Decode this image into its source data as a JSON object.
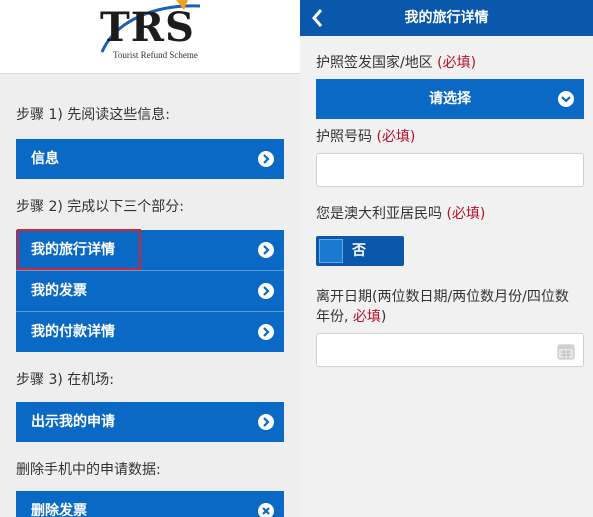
{
  "left": {
    "logo": {
      "text": "TRS",
      "subtitle": "Tourist Refund Scheme"
    },
    "step1_label": "步骤 1) 先阅读这些信息:",
    "step1_buttons": [
      "信息"
    ],
    "step2_label": "步骤 2) 完成以下三个部分:",
    "step2_buttons": [
      "我的旅行详情",
      "我的发票",
      "我的付款详情"
    ],
    "step3_label": "步骤 3) 在机场:",
    "step3_buttons": [
      "出示我的申请"
    ],
    "delete_label": "删除手机中的申请数据:",
    "delete_buttons": [
      "删除发票"
    ]
  },
  "right": {
    "nav_title": "我的旅行详情",
    "passport_country_label": "护照签发国家/地区",
    "passport_country_required": "(必填)",
    "passport_country_select": "请选择",
    "passport_number_label": "护照号码",
    "passport_number_required": "(必填)",
    "passport_number_value": "",
    "resident_label": "您是澳大利亚居民吗",
    "resident_required": "(必填)",
    "resident_toggle_value": "否",
    "departure_label_line1": "离开日期(两位数日期/两位数月份/四位数",
    "departure_label_line2": "年份,",
    "departure_required": "必填",
    "departure_label_close": ")",
    "departure_value": ""
  },
  "colors": {
    "button_blue": "#0a69c4",
    "nav_blue": "#0a58ab",
    "required_red": "#b3122a",
    "highlight_red": "#d9232d"
  }
}
